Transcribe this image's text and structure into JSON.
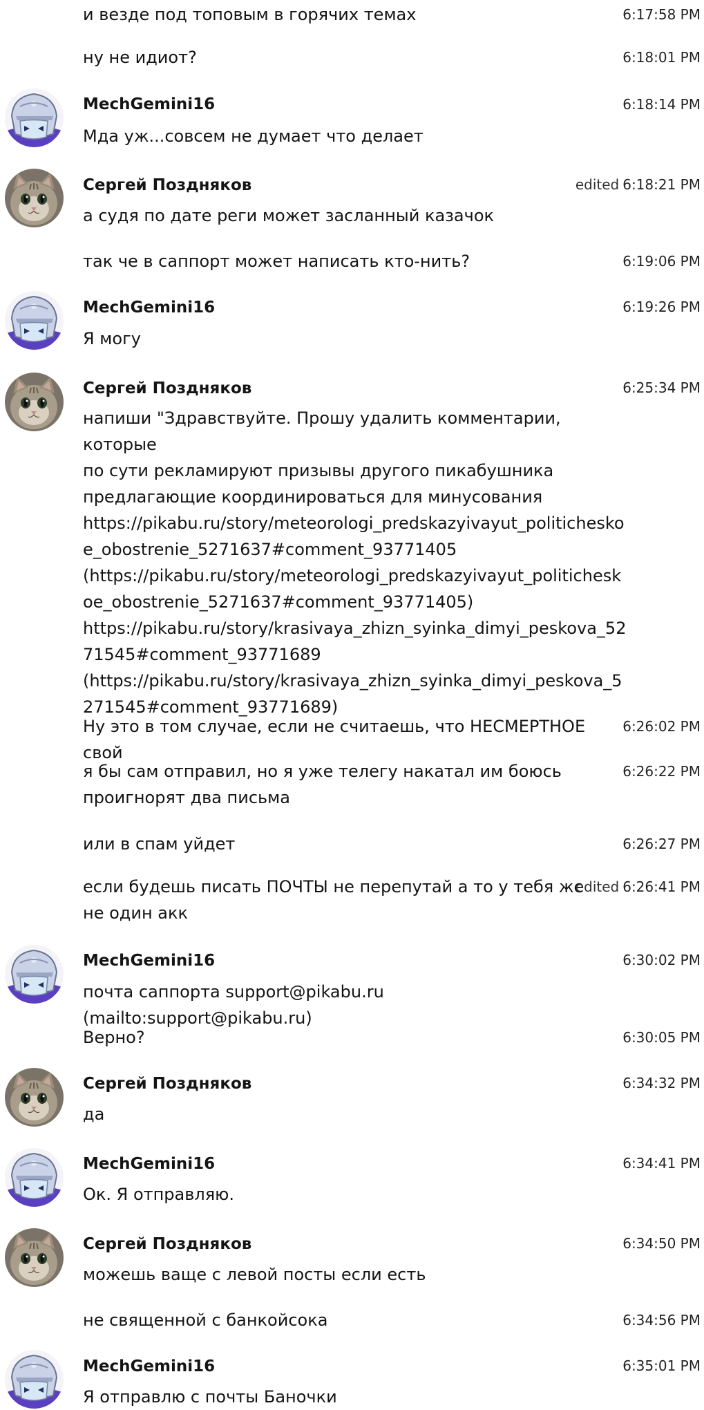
{
  "messages": [
    {
      "text": "и везде под топовым в горячих темах",
      "time": "6:17:58 PM"
    },
    {
      "text": "ну не идиот?",
      "time": "6:18:01 PM"
    },
    {
      "author": "MechGemini16",
      "text": "Мда уж...совсем не думает что делает",
      "time": "6:18:14 PM"
    },
    {
      "author": "Сергей Поздняков",
      "text": "а судя по дате реги может засланный казачок",
      "time": "6:18:21 PM",
      "edited": "edited"
    },
    {
      "text": "так че в саппорт может написать кто-нить?",
      "time": "6:19:06 PM"
    },
    {
      "author": "MechGemini16",
      "text": "Я могу",
      "time": "6:19:26 PM"
    },
    {
      "author": "Сергей Поздняков",
      "lines": [
        "напиши \"Здравствуйте. Прошу удалить комментарии, которые",
        "по сути рекламируют призывы другого пикабушника",
        "предлагающие координироваться для минусования",
        "https://pikabu.ru/story/meteorologi_predskazyivayut_politichesko",
        "e_obostrenie_5271637#comment_93771405",
        "(https://pikabu.ru/story/meteorologi_predskazyivayut_politichesk",
        "oe_obostrenie_5271637#comment_93771405)",
        "https://pikabu.ru/story/krasivaya_zhizn_syinka_dimyi_peskova_52",
        "71545#comment_93771689",
        "(https://pikabu.ru/story/krasivaya_zhizn_syinka_dimyi_peskova_5",
        "271545#comment_93771689)"
      ],
      "time": "6:25:34 PM"
    },
    {
      "text": "Ну это в том случае, если не считаешь, что НЕСМЕРТНОЕ свой",
      "time": "6:26:02 PM"
    },
    {
      "lines": [
        "я бы сам отправил, но я уже телегу накатал им боюсь",
        "проигнорят два письма"
      ],
      "time": "6:26:22 PM"
    },
    {
      "text": "или в спам уйдет",
      "time": "6:26:27 PM"
    },
    {
      "lines": [
        "если будешь писать ПОЧТЫ не перепутай а то у тебя же",
        "не один акк"
      ],
      "time": "6:26:41 PM",
      "edited": "edited"
    },
    {
      "author": "MechGemini16",
      "text": "почта саппорта support@pikabu.ru (mailto:support@pikabu.ru)",
      "time": "6:30:02 PM"
    },
    {
      "text": "Верно?",
      "time": "6:30:05 PM"
    },
    {
      "author": "Сергей Поздняков",
      "text": "да",
      "time": "6:34:32 PM"
    },
    {
      "author": "MechGemini16",
      "text": "Ок. Я отправляю.",
      "time": "6:34:41 PM"
    },
    {
      "author": "Сергей Поздняков",
      "text": "можешь ваще с левой посты если есть",
      "time": "6:34:50 PM"
    },
    {
      "text": "не священной с банкойсока",
      "time": "6:34:56 PM"
    },
    {
      "author": "MechGemini16",
      "text": "Я отправлю с почты Баночки",
      "time": "6:35:01 PM"
    }
  ]
}
